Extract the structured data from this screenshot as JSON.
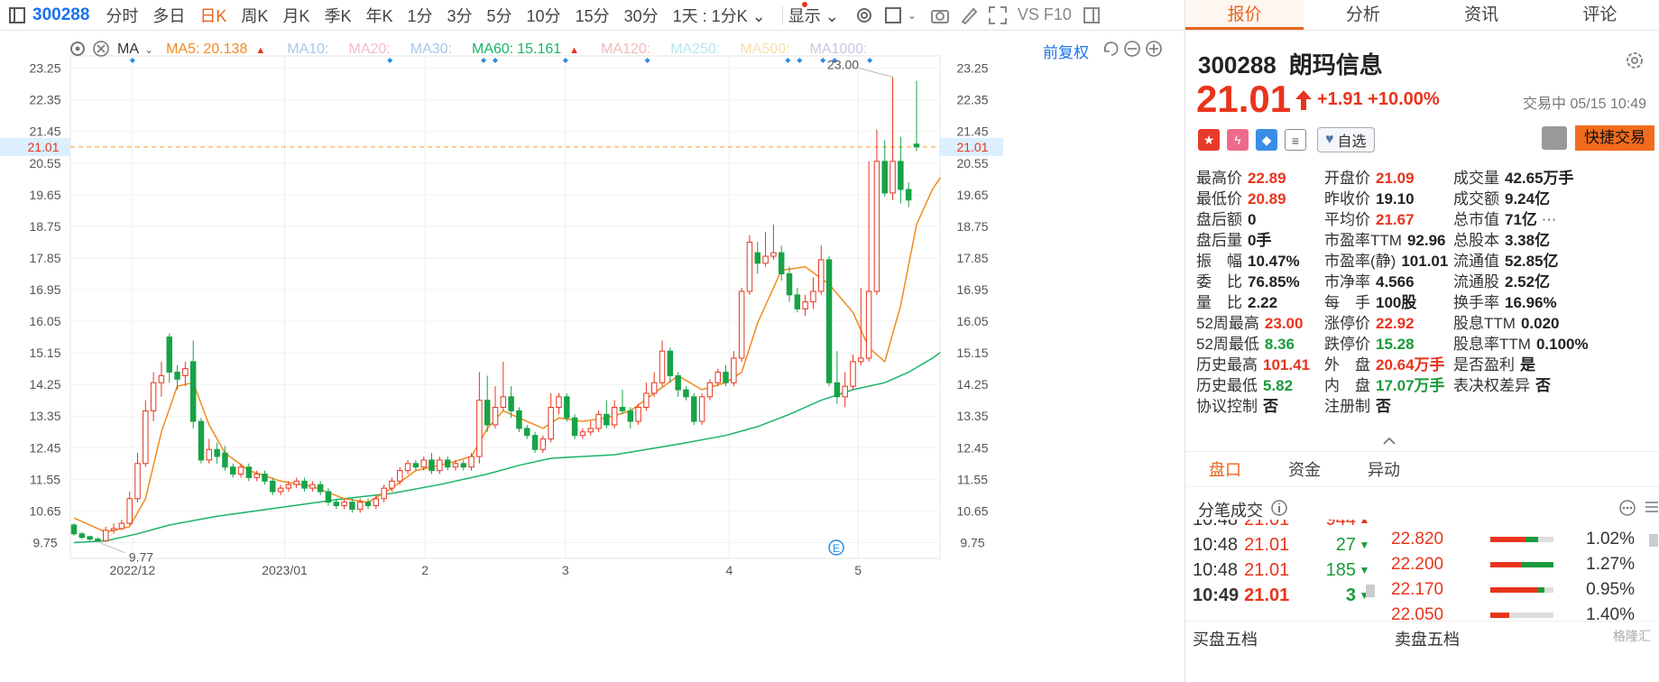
{
  "toolbar": {
    "code": "300288",
    "tabs": [
      "分时",
      "多日",
      "日K",
      "周K",
      "月K",
      "季K",
      "年K",
      "1分",
      "3分",
      "5分",
      "10分",
      "15分",
      "30分"
    ],
    "active_tab": "日K",
    "period_select": "1天 : 1分K",
    "display_label": "显示",
    "vs_label": "VS F10"
  },
  "ma_bar": {
    "label": "MA",
    "items": [
      {
        "name": "MA5:",
        "value": "20.138",
        "color": "#f28a1d",
        "faded": false,
        "arrow": "▲"
      },
      {
        "name": "MA10:",
        "value": "",
        "color": "#a7c7ea",
        "faded": true
      },
      {
        "name": "MA20:",
        "value": "",
        "color": "#f4b9d6",
        "faded": true
      },
      {
        "name": "MA30:",
        "value": "",
        "color": "#a7c7ea",
        "faded": true
      },
      {
        "name": "MA60:",
        "value": "15.161",
        "color": "#1bb36a",
        "faded": false,
        "arrow": "▲"
      },
      {
        "name": "MA120:",
        "value": "",
        "color": "#f4b9b9",
        "faded": true
      },
      {
        "name": "MA250:",
        "value": "",
        "color": "#b8e6ee",
        "faded": true
      },
      {
        "name": "MA500:",
        "value": "",
        "color": "#f8dfaa",
        "faded": true
      },
      {
        "name": "MA1000:",
        "value": "",
        "color": "#c7c7e6",
        "faded": true
      }
    ],
    "fuquan": "前复权"
  },
  "chart_data": {
    "type": "candlestick",
    "ylim": [
      9.3,
      23.6
    ],
    "y_ticks": [
      "23.25",
      "22.35",
      "21.45",
      "20.55",
      "19.65",
      "18.75",
      "17.85",
      "16.95",
      "16.05",
      "15.15",
      "14.25",
      "13.35",
      "12.45",
      "11.55",
      "10.65",
      "9.75"
    ],
    "current_price_label": "21.01",
    "current_price": 21.01,
    "high_annotation": "23.00",
    "low_annotation": "9.77",
    "x_labels": [
      {
        "text": "2022/12",
        "index": 5
      },
      {
        "text": "2023/01",
        "index": 18
      },
      {
        "text": "2",
        "index": 30
      },
      {
        "text": "3",
        "index": 42
      },
      {
        "text": "4",
        "index": 56
      },
      {
        "text": "5",
        "index": 67
      }
    ],
    "event_markers": [
      5,
      27,
      35,
      36,
      42,
      49,
      61,
      62,
      64,
      65,
      68
    ],
    "candles": [
      [
        10.25,
        10.0,
        10.3,
        9.95
      ],
      [
        10.0,
        9.9,
        10.05,
        9.85
      ],
      [
        9.92,
        9.85,
        9.95,
        9.8
      ],
      [
        9.85,
        9.8,
        9.9,
        9.77
      ],
      [
        9.8,
        10.1,
        10.2,
        9.78
      ],
      [
        10.1,
        10.15,
        10.3,
        10.0
      ],
      [
        10.15,
        10.3,
        10.4,
        10.1
      ],
      [
        10.3,
        11.0,
        11.2,
        10.25
      ],
      [
        11.0,
        12.0,
        12.3,
        10.9
      ],
      [
        12.0,
        13.5,
        13.8,
        11.9
      ],
      [
        13.5,
        14.3,
        14.6,
        13.2
      ],
      [
        14.3,
        14.5,
        14.9,
        13.9
      ],
      [
        15.6,
        14.6,
        15.7,
        14.3
      ],
      [
        14.6,
        14.4,
        14.8,
        14.1
      ],
      [
        14.5,
        14.7,
        14.9,
        14.2
      ],
      [
        14.9,
        13.2,
        15.5,
        13.0
      ],
      [
        13.2,
        12.1,
        13.3,
        12.0
      ],
      [
        12.1,
        12.4,
        12.7,
        12.0
      ],
      [
        12.4,
        12.2,
        12.6,
        12.0
      ],
      [
        12.3,
        11.9,
        12.5,
        11.8
      ],
      [
        11.9,
        11.7,
        12.0,
        11.6
      ],
      [
        11.7,
        11.9,
        12.0,
        11.6
      ],
      [
        11.9,
        11.6,
        12.0,
        11.5
      ],
      [
        11.6,
        11.7,
        11.8,
        11.5
      ],
      [
        11.7,
        11.5,
        11.8,
        11.4
      ],
      [
        11.5,
        11.2,
        11.6,
        11.1
      ],
      [
        11.2,
        11.3,
        11.4,
        11.1
      ],
      [
        11.3,
        11.4,
        11.5,
        11.2
      ],
      [
        11.4,
        11.5,
        11.6,
        11.3
      ],
      [
        11.5,
        11.3,
        11.6,
        11.2
      ],
      [
        11.3,
        11.4,
        11.5,
        11.2
      ],
      [
        11.4,
        11.2,
        11.5,
        11.1
      ],
      [
        11.2,
        10.9,
        11.3,
        10.8
      ],
      [
        10.9,
        10.8,
        11.0,
        10.7
      ],
      [
        10.8,
        10.9,
        11.0,
        10.7
      ],
      [
        10.9,
        10.7,
        11.0,
        10.6
      ],
      [
        10.7,
        10.9,
        11.0,
        10.6
      ],
      [
        10.9,
        10.8,
        11.0,
        10.7
      ],
      [
        10.8,
        11.0,
        11.1,
        10.7
      ],
      [
        11.0,
        11.3,
        11.4,
        10.9
      ],
      [
        11.3,
        11.5,
        11.6,
        11.2
      ],
      [
        11.5,
        11.8,
        11.9,
        11.4
      ],
      [
        11.8,
        12.0,
        12.1,
        11.7
      ],
      [
        12.0,
        11.9,
        12.1,
        11.8
      ],
      [
        11.9,
        12.1,
        12.2,
        11.8
      ],
      [
        12.1,
        11.8,
        12.3,
        11.7
      ],
      [
        11.8,
        12.1,
        12.2,
        11.7
      ],
      [
        12.1,
        11.9,
        12.2,
        11.8
      ],
      [
        11.9,
        12.0,
        12.1,
        11.8
      ],
      [
        12.0,
        11.9,
        12.1,
        11.8
      ],
      [
        11.9,
        12.2,
        12.3,
        11.8
      ],
      [
        12.2,
        13.8,
        14.6,
        12.0
      ],
      [
        13.8,
        13.1,
        14.5,
        12.9
      ],
      [
        13.1,
        13.6,
        14.2,
        13.0
      ],
      [
        13.6,
        13.9,
        14.9,
        13.5
      ],
      [
        13.9,
        13.5,
        14.2,
        13.3
      ],
      [
        13.5,
        13.0,
        13.6,
        12.9
      ],
      [
        13.0,
        12.8,
        13.1,
        12.7
      ],
      [
        12.8,
        12.4,
        12.9,
        12.3
      ],
      [
        12.4,
        12.7,
        12.8,
        12.3
      ],
      [
        12.7,
        13.6,
        14.0,
        12.6
      ],
      [
        13.6,
        13.9,
        14.0,
        13.4
      ],
      [
        13.9,
        13.3,
        14.0,
        13.2
      ],
      [
        13.3,
        12.8,
        13.4,
        12.7
      ],
      [
        12.8,
        12.9,
        13.0,
        12.7
      ],
      [
        12.9,
        13.0,
        13.2,
        12.8
      ],
      [
        13.0,
        13.4,
        13.5,
        12.9
      ],
      [
        13.4,
        13.1,
        13.8,
        13.0
      ],
      [
        13.1,
        13.6,
        13.8,
        13.0
      ],
      [
        13.6,
        13.5,
        14.1,
        13.4
      ],
      [
        13.5,
        13.2,
        13.6,
        13.0
      ],
      [
        13.2,
        13.6,
        13.7,
        13.1
      ],
      [
        13.6,
        14.0,
        14.3,
        13.5
      ],
      [
        14.0,
        14.3,
        14.6,
        13.9
      ],
      [
        14.3,
        15.2,
        15.5,
        14.2
      ],
      [
        15.2,
        14.5,
        15.3,
        14.3
      ],
      [
        14.5,
        14.1,
        14.6,
        13.9
      ],
      [
        14.1,
        13.9,
        14.2,
        13.8
      ],
      [
        13.9,
        13.2,
        14.0,
        13.1
      ],
      [
        13.2,
        13.9,
        14.0,
        13.1
      ],
      [
        13.9,
        14.3,
        14.4,
        13.8
      ],
      [
        14.3,
        14.6,
        14.7,
        14.2
      ],
      [
        14.6,
        14.3,
        14.8,
        14.2
      ],
      [
        14.3,
        15.0,
        15.2,
        14.2
      ],
      [
        15.0,
        16.9,
        17.0,
        14.9
      ],
      [
        16.9,
        18.3,
        18.5,
        16.8
      ],
      [
        18.0,
        17.7,
        18.3,
        17.4
      ],
      [
        17.7,
        17.9,
        18.6,
        17.6
      ],
      [
        17.9,
        18.0,
        18.8,
        17.8
      ],
      [
        18.0,
        17.4,
        18.2,
        17.2
      ],
      [
        17.4,
        16.8,
        17.6,
        16.6
      ],
      [
        16.8,
        16.4,
        17.0,
        16.3
      ],
      [
        16.4,
        16.6,
        16.8,
        16.2
      ],
      [
        16.6,
        16.9,
        17.3,
        16.4
      ],
      [
        16.9,
        17.8,
        18.2,
        16.8
      ],
      [
        17.8,
        14.3,
        17.9,
        14.2
      ],
      [
        14.3,
        13.9,
        15.2,
        13.7
      ],
      [
        13.9,
        14.2,
        14.6,
        13.6
      ],
      [
        14.2,
        14.9,
        15.1,
        14.1
      ],
      [
        14.9,
        15.0,
        17.0,
        14.8
      ],
      [
        15.0,
        16.9,
        20.6,
        14.9
      ],
      [
        16.9,
        20.6,
        21.5,
        16.8
      ],
      [
        20.6,
        19.7,
        21.2,
        19.6
      ],
      [
        19.7,
        20.6,
        23.0,
        19.5
      ],
      [
        20.6,
        19.8,
        21.3,
        19.4
      ],
      [
        19.8,
        19.5,
        20.0,
        19.3
      ],
      [
        21.09,
        21.01,
        22.89,
        20.89
      ]
    ],
    "ma5": [
      [
        0,
        10.45
      ],
      [
        4,
        10.05
      ],
      [
        7,
        10.2
      ],
      [
        9,
        11.0
      ],
      [
        11,
        12.9
      ],
      [
        13,
        14.2
      ],
      [
        15,
        14.3
      ],
      [
        17,
        13.1
      ],
      [
        19,
        12.3
      ],
      [
        22,
        11.8
      ],
      [
        26,
        11.5
      ],
      [
        30,
        11.35
      ],
      [
        34,
        11.0
      ],
      [
        37,
        10.9
      ],
      [
        40,
        11.3
      ],
      [
        43,
        11.8
      ],
      [
        47,
        12.0
      ],
      [
        50,
        12.2
      ],
      [
        52,
        13.0
      ],
      [
        54,
        13.5
      ],
      [
        57,
        13.2
      ],
      [
        59,
        13.0
      ],
      [
        61,
        13.3
      ],
      [
        64,
        13.2
      ],
      [
        67,
        13.3
      ],
      [
        70,
        13.5
      ],
      [
        73,
        14.0
      ],
      [
        76,
        14.5
      ],
      [
        79,
        14.1
      ],
      [
        82,
        14.3
      ],
      [
        84,
        14.6
      ],
      [
        86,
        16.0
      ],
      [
        89,
        17.5
      ],
      [
        92,
        17.6
      ],
      [
        95,
        17.1
      ],
      [
        98,
        16.3
      ],
      [
        100,
        15.3
      ],
      [
        102,
        14.9
      ],
      [
        104,
        16.5
      ],
      [
        106,
        18.8
      ],
      [
        108,
        19.8
      ],
      [
        109,
        20.14
      ]
    ],
    "ma60": [
      [
        0,
        9.75
      ],
      [
        4,
        9.8
      ],
      [
        8,
        10.0
      ],
      [
        12,
        10.25
      ],
      [
        18,
        10.5
      ],
      [
        26,
        10.75
      ],
      [
        34,
        11.0
      ],
      [
        40,
        11.15
      ],
      [
        46,
        11.4
      ],
      [
        52,
        11.7
      ],
      [
        56,
        11.95
      ],
      [
        60,
        12.15
      ],
      [
        64,
        12.2
      ],
      [
        68,
        12.25
      ],
      [
        72,
        12.4
      ],
      [
        76,
        12.55
      ],
      [
        82,
        12.8
      ],
      [
        86,
        13.05
      ],
      [
        90,
        13.4
      ],
      [
        94,
        13.8
      ],
      [
        98,
        14.1
      ],
      [
        102,
        14.3
      ],
      [
        105,
        14.6
      ],
      [
        108,
        15.0
      ],
      [
        109,
        15.16
      ]
    ]
  },
  "quote": {
    "code": "300288",
    "name": "朗玛信息",
    "price": "21.01",
    "change": "+1.91",
    "change_pct": "+10.00%",
    "trade_status": "交易中 05/15 10:49",
    "watch_label": "自选",
    "quick_trade": "快捷交易"
  },
  "right_tabs": [
    "报价",
    "分析",
    "资讯",
    "评论"
  ],
  "stats": [
    [
      {
        "label": "最高价",
        "value": "22.89",
        "color": "red"
      },
      {
        "label": "开盘价",
        "value": "21.09",
        "color": "red"
      },
      {
        "label": "成交量",
        "value": "42.65万手",
        "color": "black"
      }
    ],
    [
      {
        "label": "最低价",
        "value": "20.89",
        "color": "red"
      },
      {
        "label": "昨收价",
        "value": "19.10",
        "color": "black"
      },
      {
        "label": "成交额",
        "value": "9.24亿",
        "color": "black"
      }
    ],
    [
      {
        "label": "盘后额",
        "value": "0",
        "color": "black"
      },
      {
        "label": "平均价",
        "value": "21.67",
        "color": "red"
      },
      {
        "label": "总市值",
        "value": "71亿",
        "color": "black"
      }
    ],
    [
      {
        "label": "盘后量",
        "value": "0手",
        "color": "black"
      },
      {
        "label": "市盈率TTM",
        "value": "92.96",
        "color": "black"
      },
      {
        "label": "总股本",
        "value": "3.38亿",
        "color": "black"
      }
    ],
    [
      {
        "label": "振　幅",
        "value": "10.47%",
        "color": "black"
      },
      {
        "label": "市盈率(静)",
        "value": "101.01",
        "color": "black"
      },
      {
        "label": "流通值",
        "value": "52.85亿",
        "color": "black"
      }
    ],
    [
      {
        "label": "委　比",
        "value": "76.85%",
        "color": "black"
      },
      {
        "label": "市净率",
        "value": "4.566",
        "color": "black"
      },
      {
        "label": "流通股",
        "value": "2.52亿",
        "color": "black"
      }
    ],
    [
      {
        "label": "量　比",
        "value": "2.22",
        "color": "black"
      },
      {
        "label": "每　手",
        "value": "100股",
        "color": "black"
      },
      {
        "label": "换手率",
        "value": "16.96%",
        "color": "black"
      }
    ],
    [
      {
        "label": "52周最高",
        "value": "23.00",
        "color": "red"
      },
      {
        "label": "涨停价",
        "value": "22.92",
        "color": "red"
      },
      {
        "label": "股息TTM",
        "value": "0.020",
        "color": "black"
      }
    ],
    [
      {
        "label": "52周最低",
        "value": "8.36",
        "color": "green"
      },
      {
        "label": "跌停价",
        "value": "15.28",
        "color": "green"
      },
      {
        "label": "股息率TTM",
        "value": "0.100%",
        "color": "black"
      }
    ],
    [
      {
        "label": "历史最高",
        "value": "101.41",
        "color": "red"
      },
      {
        "label": "外　盘",
        "value": "20.64万手",
        "color": "red"
      },
      {
        "label": "是否盈利",
        "value": "是",
        "color": "black"
      }
    ],
    [
      {
        "label": "历史最低",
        "value": "5.82",
        "color": "green"
      },
      {
        "label": "内　盘",
        "value": "17.07万手",
        "color": "green"
      },
      {
        "label": "表决权差异",
        "value": "否",
        "color": "black"
      }
    ],
    [
      {
        "label": "协议控制",
        "value": "否",
        "color": "black"
      },
      {
        "label": "注册制",
        "value": "否",
        "color": "black"
      },
      {
        "label": "",
        "value": "",
        "color": "black"
      }
    ]
  ],
  "sub_tabs": [
    "盘口",
    "资金",
    "异动"
  ],
  "fenbi_title": "分笔成交",
  "ticks": [
    {
      "time": "10:48",
      "price": "21.01",
      "vol": "944",
      "dir": "up"
    },
    {
      "time": "10:48",
      "price": "21.01",
      "vol": "27",
      "dir": "down"
    },
    {
      "time": "10:48",
      "price": "21.01",
      "vol": "185",
      "dir": "down"
    },
    {
      "time": "10:49",
      "price": "21.01",
      "vol": "3",
      "dir": "down"
    }
  ],
  "levels": [
    {
      "price": "22.820",
      "pct": "1.02%",
      "red": 0.55,
      "green": 0.2
    },
    {
      "price": "22.200",
      "pct": "1.27%",
      "red": 0.5,
      "green": 0.5
    },
    {
      "price": "22.170",
      "pct": "0.95%",
      "red": 0.75,
      "green": 0.1
    },
    {
      "price": "22.050",
      "pct": "1.40%",
      "red": 0.3,
      "green": 0.0
    }
  ],
  "buy5": "买盘五档",
  "sell5": "卖盘五档",
  "watermark": "格隆汇"
}
